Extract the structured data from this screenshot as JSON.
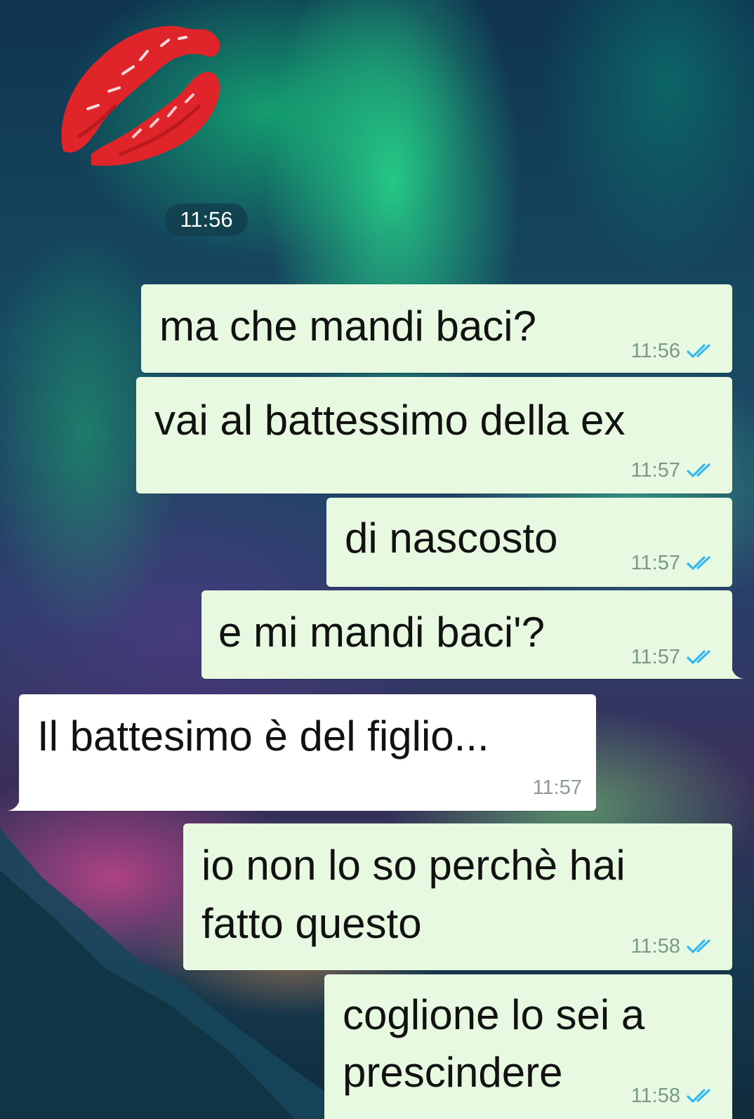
{
  "chat": {
    "sticker": {
      "icon": "kiss-lips-icon",
      "time": "11:56"
    },
    "messages": [
      {
        "direction": "outgoing",
        "text": "ma che mandi baci?",
        "time": "11:56",
        "status": "read"
      },
      {
        "direction": "outgoing",
        "text": "vai al battessimo della ex",
        "time": "11:57",
        "status": "read"
      },
      {
        "direction": "outgoing",
        "text": "di nascosto",
        "time": "11:57",
        "status": "read"
      },
      {
        "direction": "outgoing",
        "text": "e mi mandi baci'?",
        "time": "11:57",
        "status": "read"
      },
      {
        "direction": "incoming",
        "text": "Il battesimo è del figlio...",
        "time": "11:57"
      },
      {
        "direction": "outgoing",
        "text_lines": [
          "io non lo so perchè hai",
          "fatto questo"
        ],
        "time": "11:58",
        "status": "read"
      },
      {
        "direction": "outgoing",
        "text_lines": [
          "coglione lo sei a",
          "prescindere"
        ],
        "time": "11:58",
        "status": "read"
      }
    ]
  },
  "colors": {
    "outgoing_bubble": "#e7f9e0",
    "incoming_bubble": "#ffffff",
    "read_tick": "#34b7f1",
    "time_pill": "#123e4e"
  }
}
